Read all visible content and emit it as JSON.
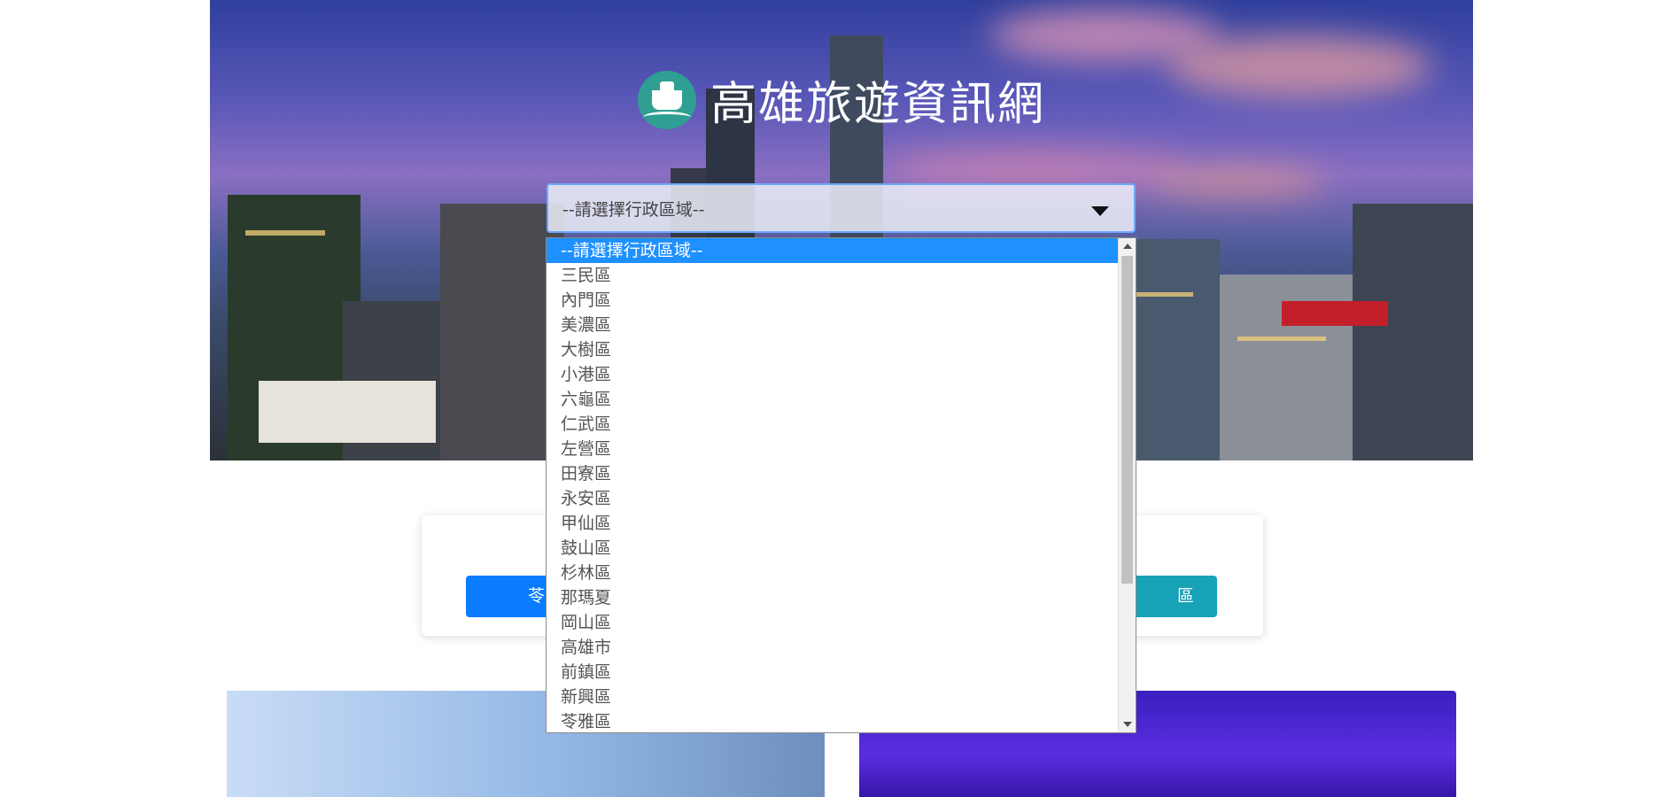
{
  "site": {
    "title": "高雄旅遊資訊網"
  },
  "district_select": {
    "selected": "--請選擇行政區域--",
    "options": [
      "--請選擇行政區域--",
      "三民區",
      "內門區",
      "美濃區",
      "大樹區",
      "小港區",
      "六龜區",
      "仁武區",
      "左營區",
      "田寮區",
      "永安區",
      "甲仙區",
      "鼓山區",
      "杉林區",
      "那瑪夏",
      "岡山區",
      "高雄市",
      "前鎮區",
      "新興區",
      "苓雅區"
    ]
  },
  "quick_buttons": {
    "left_label": "苓",
    "right_label": "區"
  },
  "colors": {
    "accent_blue": "#0b7bff",
    "accent_teal": "#17a2b8",
    "highlight": "#1e90ff",
    "logo_teal": "#2f9f93"
  },
  "icons": {
    "logo": "ship-logo-icon",
    "dropdown": "caret-down-icon"
  }
}
